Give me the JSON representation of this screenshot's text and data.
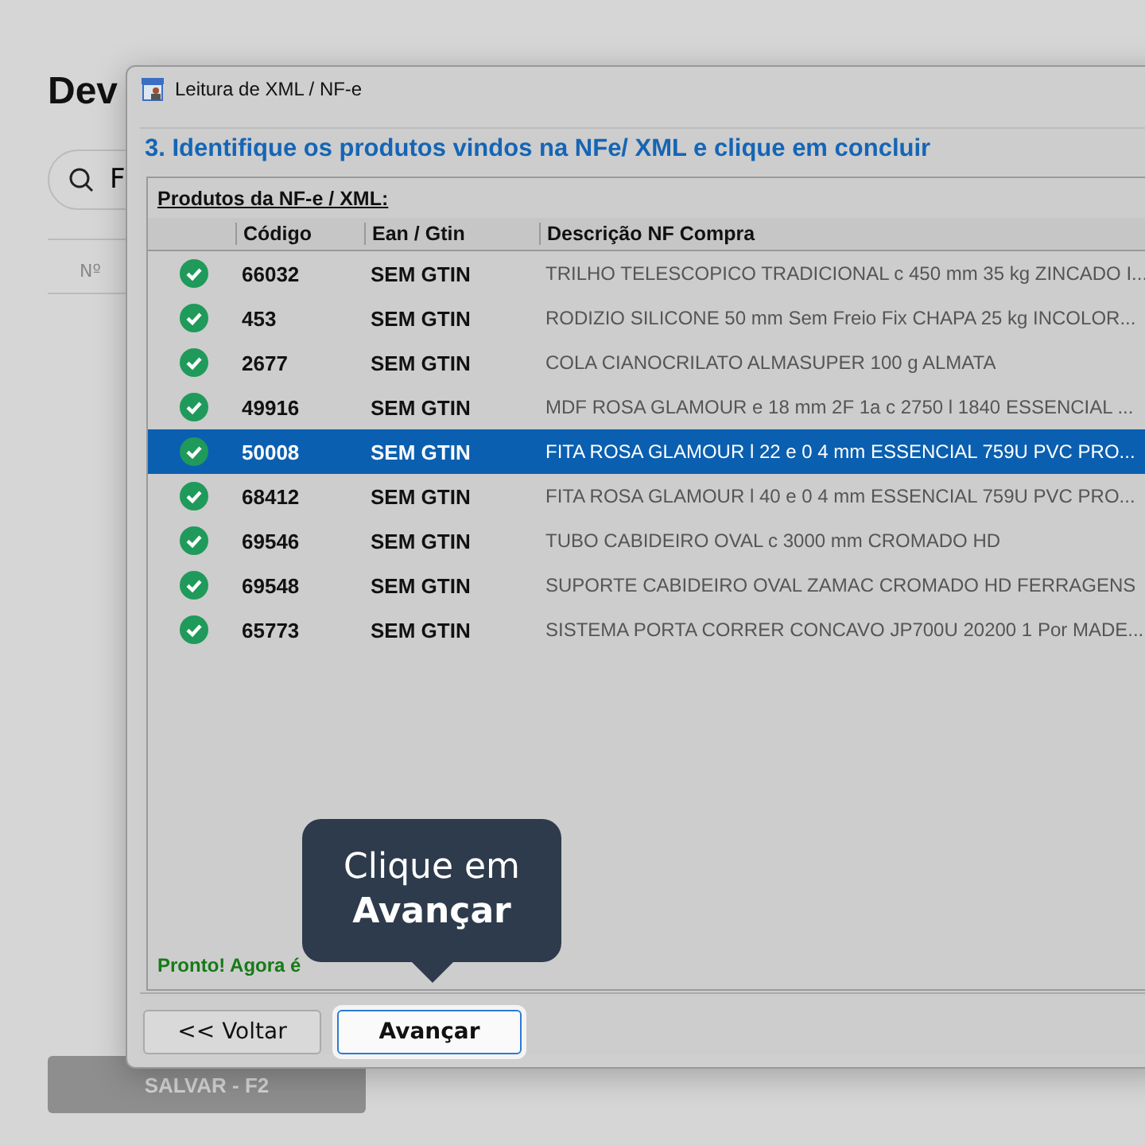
{
  "page": {
    "title": "Dev",
    "search": {
      "value": "F"
    },
    "table": {
      "columns": [
        "Nº"
      ]
    },
    "save_button": {
      "label": "SALVAR - F2",
      "disabled": true
    }
  },
  "dialog": {
    "title": "Leitura de XML / NF-e",
    "step_heading": "3. Identifique os produtos vindos na NFe/ XML e clique em concluir",
    "group_label": "Produtos da NF-e / XML:",
    "table": {
      "columns": [
        "",
        "Código",
        "Ean / Gtin",
        "Descrição NF Compra"
      ],
      "rows": [
        {
          "checked": true,
          "selected": false,
          "code": "66032",
          "ean": "SEM GTIN",
          "description": "TRILHO TELESCOPICO TRADICIONAL c 450 mm 35 kg ZINCADO I..."
        },
        {
          "checked": true,
          "selected": false,
          "code": "453",
          "ean": "SEM GTIN",
          "description": "RODIZIO SILICONE 50 mm Sem Freio Fix CHAPA 25 kg INCOLOR..."
        },
        {
          "checked": true,
          "selected": false,
          "code": "2677",
          "ean": "SEM GTIN",
          "description": "COLA CIANOCRILATO ALMASUPER 100 g ALMATA"
        },
        {
          "checked": true,
          "selected": false,
          "code": "49916",
          "ean": "SEM GTIN",
          "description": "MDF ROSA GLAMOUR e 18 mm 2F 1a c 2750 l 1840 ESSENCIAL ..."
        },
        {
          "checked": true,
          "selected": true,
          "code": "50008",
          "ean": "SEM GTIN",
          "description": "FITA ROSA GLAMOUR l 22 e 0 4 mm ESSENCIAL 759U PVC PRO..."
        },
        {
          "checked": true,
          "selected": false,
          "code": "68412",
          "ean": "SEM GTIN",
          "description": "FITA ROSA GLAMOUR l 40 e 0 4 mm ESSENCIAL 759U PVC PRO..."
        },
        {
          "checked": true,
          "selected": false,
          "code": "69546",
          "ean": "SEM GTIN",
          "description": "TUBO CABIDEIRO OVAL c 3000 mm CROMADO HD"
        },
        {
          "checked": true,
          "selected": false,
          "code": "69548",
          "ean": "SEM GTIN",
          "description": "SUPORTE CABIDEIRO OVAL ZAMAC CROMADO HD FERRAGENS"
        },
        {
          "checked": true,
          "selected": false,
          "code": "65773",
          "ean": "SEM GTIN",
          "description": "SISTEMA PORTA CORRER CONCAVO JP700U 20200 1 Por MADE..."
        }
      ]
    },
    "status_text": "Pronto! Agora é",
    "buttons": [
      {
        "label": "<< Voltar",
        "focused": false
      },
      {
        "label": "Avançar",
        "focused": true
      }
    ]
  },
  "tooltip": {
    "line_1": "Clique em",
    "line_2": "Avançar"
  }
}
